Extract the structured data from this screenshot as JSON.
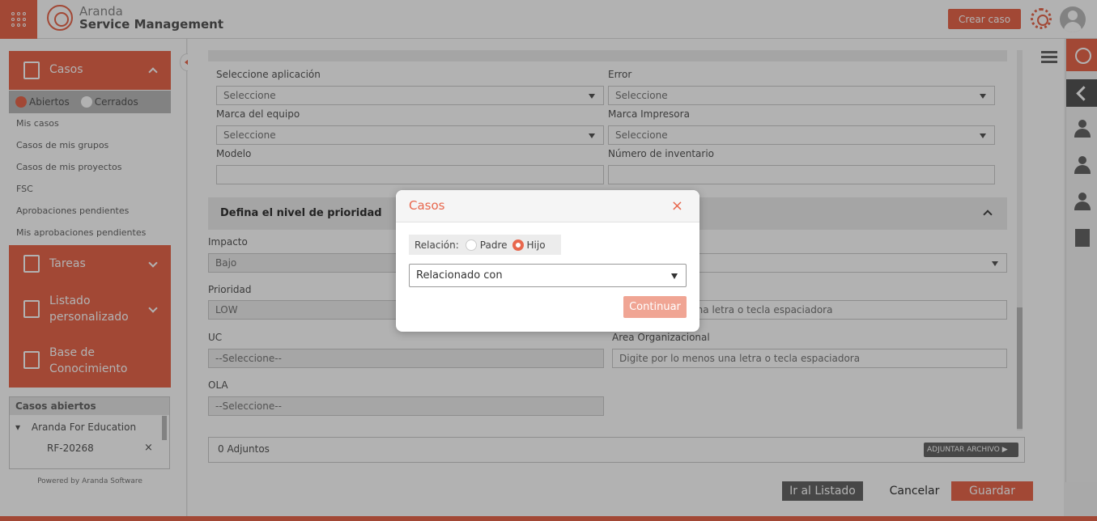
{
  "header": {
    "brand_line1": "Aranda",
    "brand_line2": "Service Management",
    "create_case": "Crear caso"
  },
  "sidebar": {
    "casos": "Casos",
    "filter_open": "Abiertos",
    "filter_closed": "Cerrados",
    "links": [
      "Mis casos",
      "Casos de mis grupos",
      "Casos de mis proyectos",
      "FSC",
      "Aprobaciones pendientes",
      "Mis aprobaciones pendientes"
    ],
    "tareas": "Tareas",
    "listado_1": "Listado",
    "listado_2": "personalizado",
    "base_1": "Base de",
    "base_2": "Conocimiento",
    "open_cases_title": "Casos abiertos",
    "tree_parent": "Aranda For Education",
    "tree_child": "RF-20268",
    "powered": "Powered by Aranda Software"
  },
  "form": {
    "app_label": "Seleccione aplicación",
    "app_value": "Seleccione",
    "error_label": "Error",
    "error_value": "Seleccione",
    "brand_label": "Marca del equipo",
    "brand_value": "Seleccione",
    "printer_label": "Marca Impresora",
    "printer_value": "Seleccione",
    "model_label": "Modelo",
    "model_value": "",
    "inventory_label": "Número de inventario",
    "inventory_value": "",
    "priority_section": "Defina el nivel de prioridad",
    "impact_label": "Impacto",
    "impact_value": "Bajo",
    "priority_label": "Prioridad",
    "priority_value": "LOW",
    "right_field_value": "s una letra o tecla espaciadora",
    "uc_label": "UC",
    "uc_value": "--Seleccione--",
    "area_label": "Area Organizacional",
    "area_value": "Digite por lo menos una letra o tecla espaciadora",
    "ola_label": "OLA",
    "ola_value": "--Seleccione--",
    "attachments": "0 Adjuntos",
    "attach_btn": "ADJUNTAR ARCHIVO ▶"
  },
  "actions": {
    "list": "Ir al Listado",
    "cancel": "Cancelar",
    "save": "Guardar"
  },
  "modal": {
    "title": "Casos",
    "close": "×",
    "relation_label": "Relación:",
    "opt_parent": "Padre",
    "opt_child": "Hijo",
    "selected_option": "Hijo",
    "select_value": "Relacionado con",
    "continue": "Continuar"
  },
  "colors": {
    "accent": "#e8674d",
    "accent_light": "#f0a594"
  }
}
